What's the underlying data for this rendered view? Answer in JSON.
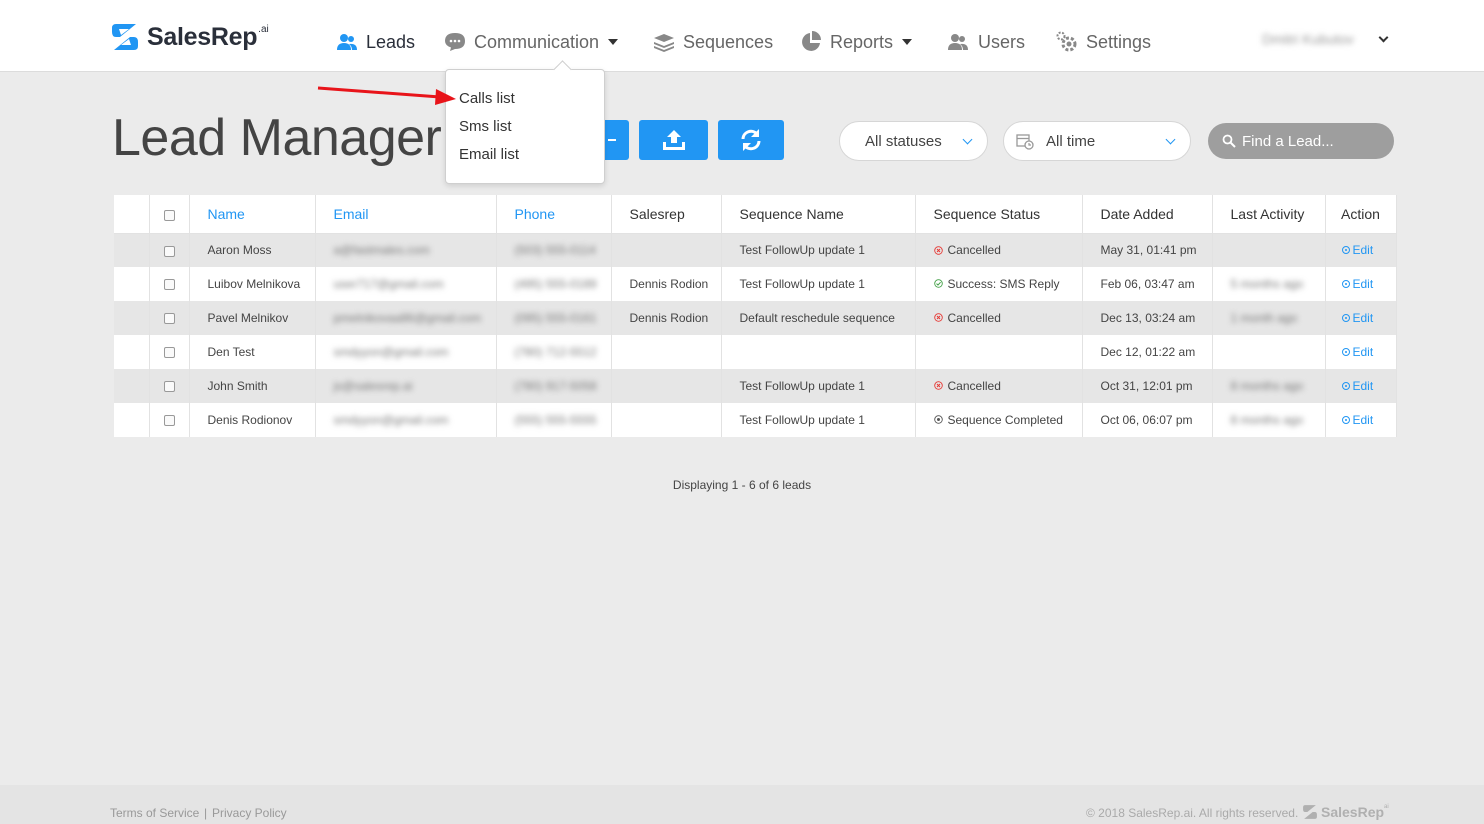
{
  "brand": {
    "name": "SalesRep",
    "suffix": ".ai",
    "color": "#2196f3"
  },
  "nav": {
    "leads": "Leads",
    "communication": "Communication",
    "sequences": "Sequences",
    "reports": "Reports",
    "users": "Users",
    "settings": "Settings"
  },
  "user": {
    "name": "Dmitri Kubutov"
  },
  "dropdown": {
    "items": [
      "Calls list",
      "Sms list",
      "Email list"
    ]
  },
  "page": {
    "title": "Lead Manager"
  },
  "filters": {
    "status": "All statuses",
    "time": "All time",
    "search_placeholder": "Find a Lead..."
  },
  "table": {
    "headers": {
      "name": "Name",
      "email": "Email",
      "phone": "Phone",
      "salesrep": "Salesrep",
      "sequence_name": "Sequence Name",
      "sequence_status": "Sequence Status",
      "date_added": "Date Added",
      "last_activity": "Last Activity",
      "action": "Action"
    },
    "rows": [
      {
        "name": "Aaron Moss",
        "email": "a@fastmales.com",
        "phone": "(503) 555-0114",
        "salesrep": "",
        "sequence": "Test FollowUp update 1",
        "status": "Cancelled",
        "status_kind": "cancelled",
        "date": "May 31, 01:41 pm",
        "last": "",
        "action": "Edit"
      },
      {
        "name": "Luibov Melnikova",
        "email": "user717@gmail.com",
        "phone": "(495) 555-0189",
        "salesrep": "Dennis Rodion",
        "sequence": "Test FollowUp update 1",
        "status": "Success: SMS Reply",
        "status_kind": "success",
        "date": "Feb 06, 03:47 am",
        "last": "5 months ago",
        "action": "Edit"
      },
      {
        "name": "Pavel Melnikov",
        "email": "pmelnikovaa86@gmail.com",
        "phone": "(095) 555-0161",
        "salesrep": "Dennis Rodion",
        "sequence": "Default reschedule sequence",
        "status": "Cancelled",
        "status_kind": "cancelled",
        "date": "Dec 13, 03:24 am",
        "last": "1 month ago",
        "action": "Edit"
      },
      {
        "name": "Den Test",
        "email": "smdyyon@gmail.com",
        "phone": "(780) 712-5512",
        "salesrep": "",
        "sequence": "",
        "status": "",
        "status_kind": "",
        "date": "Dec 12, 01:22 am",
        "last": "",
        "action": "Edit"
      },
      {
        "name": "John Smith",
        "email": "js@salesrep.ai",
        "phone": "(780) 917-5058",
        "salesrep": "",
        "sequence": "Test FollowUp update 1",
        "status": "Cancelled",
        "status_kind": "cancelled",
        "date": "Oct 31, 12:01 pm",
        "last": "8 months ago",
        "action": "Edit"
      },
      {
        "name": "Denis Rodionov",
        "email": "smdyyon@gmail.com",
        "phone": "(555) 555-5555",
        "salesrep": "",
        "sequence": "Test FollowUp update 1",
        "status": "Sequence Completed",
        "status_kind": "completed",
        "date": "Oct 06, 06:07 pm",
        "last": "8 months ago",
        "action": "Edit"
      }
    ]
  },
  "pager": {
    "prefix": "Displaying",
    "range": "1 - 6",
    "of_word": "of",
    "total": "6",
    "suffix": "leads"
  },
  "footer": {
    "terms": "Terms of Service",
    "separator": "|",
    "privacy": "Privacy Policy",
    "copyright": "© 2018 SalesRep.ai. All rights reserved.",
    "logo_text": "SalesRep",
    "logo_suffix": "ai"
  },
  "colors": {
    "accent": "#2196f3",
    "cancel": "#e53935",
    "success": "#43a047",
    "completed": "#555555",
    "arrow": "#e8141a"
  }
}
